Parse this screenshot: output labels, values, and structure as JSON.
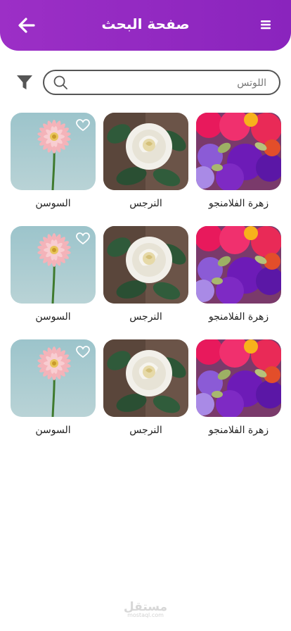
{
  "header": {
    "title": "صفحة البحث",
    "back_icon": "arrow-left-icon",
    "menu_icon": "hamburger-menu-icon"
  },
  "search": {
    "value": "",
    "placeholder": "اللوتس",
    "icon": "search-icon",
    "filter_icon": "filter-funnel-icon"
  },
  "rows": [
    {
      "items": [
        {
          "label": "السوسن",
          "image": "pink-gerbera-flower",
          "favorite": true
        },
        {
          "label": "النرجس",
          "image": "white-rose"
        },
        {
          "label": "زهرة الفلامنجو",
          "image": "pink-purple-flowers"
        }
      ]
    },
    {
      "items": [
        {
          "label": "السوسن",
          "image": "pink-gerbera-flower",
          "favorite": true
        },
        {
          "label": "النرجس",
          "image": "white-rose"
        },
        {
          "label": "زهرة الفلامنجو",
          "image": "pink-purple-flowers"
        }
      ]
    },
    {
      "items": [
        {
          "label": "السوسن",
          "image": "pink-gerbera-flower",
          "favorite": true
        },
        {
          "label": "النرجس",
          "image": "white-rose"
        },
        {
          "label": "زهرة الفلامنجو",
          "image": "pink-purple-flowers"
        }
      ]
    }
  ],
  "watermark": {
    "logo_text": "مستقل",
    "sub_text": "mostaql.com"
  },
  "colors": {
    "primary": "#9c2fc6",
    "text": "#222222"
  }
}
